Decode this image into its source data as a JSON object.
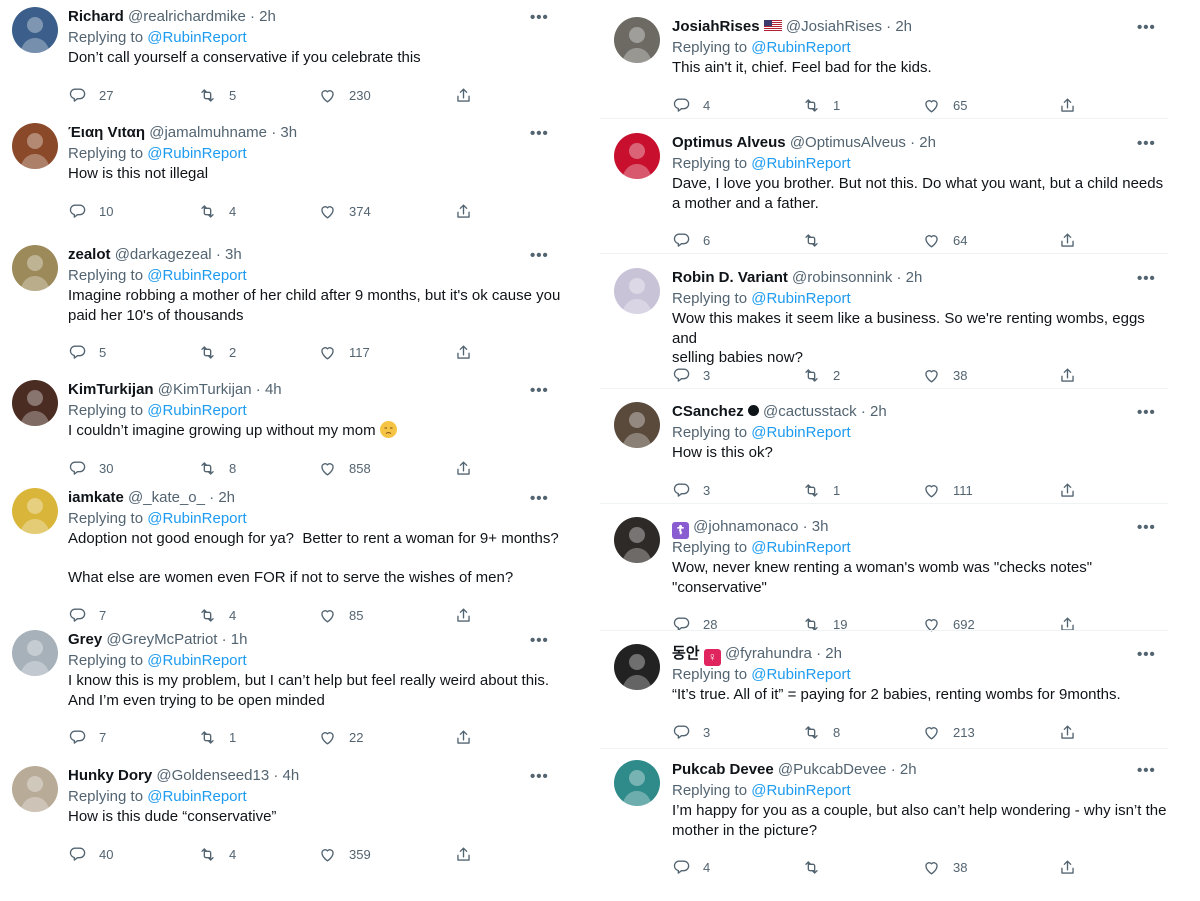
{
  "reply_prefix": "Replying to",
  "reply_to": "@RubinReport",
  "left": [
    {
      "name": "Richard",
      "handle": "@realrichardmike",
      "time": "· 2h",
      "text": "Don’t call yourself a conservative if you celebrate this",
      "replies": "27",
      "retweets": "5",
      "likes": "230",
      "avatar_color": "#3b5f8a"
    },
    {
      "name": "Έιαη Vιtαη",
      "handle": "@jamalmuhname",
      "time": "· 3h",
      "text": "How is this not illegal",
      "replies": "10",
      "retweets": "4",
      "likes": "374",
      "avatar_color": "#8a4a2a"
    },
    {
      "name": "zealot",
      "handle": "@darkagezeal",
      "time": "· 3h",
      "text": "Imagine robbing a mother of her child after 9 months, but it's ok cause you\npaid her 10's of thousands",
      "replies": "5",
      "retweets": "2",
      "likes": "117",
      "avatar_color": "#9c8a5a"
    },
    {
      "name": "KimTurkijan",
      "handle": "@KimTurkijan",
      "time": "· 4h",
      "text": "I couldn’t imagine growing up without my mom",
      "emoji": "pensive-face",
      "replies": "30",
      "retweets": "8",
      "likes": "858",
      "avatar_color": "#4a2c22"
    },
    {
      "name": "iamkate",
      "handle": "@_kate_o_",
      "time": "· 2h",
      "text": "Adoption not good enough for ya?  Better to rent a woman for 9+ months?\n\nWhat else are women even FOR if not to serve the wishes of men?",
      "replies": "7",
      "retweets": "4",
      "likes": "85",
      "avatar_color": "#d9b53a"
    },
    {
      "name": "Grey",
      "handle": "@GreyMcPatriot",
      "time": "· 1h",
      "text": "I know this is my problem, but I can’t help but feel really weird about this.\nAnd I’m even trying to be open minded",
      "replies": "7",
      "retweets": "1",
      "likes": "22",
      "avatar_color": "#a7b1ba"
    },
    {
      "name": "Hunky Dory",
      "handle": "@Goldenseed13",
      "time": "· 4h",
      "text": "How is this dude “conservative”",
      "replies": "40",
      "retweets": "4",
      "likes": "359",
      "avatar_color": "#b8ab98"
    }
  ],
  "right": [
    {
      "name": "JosiahRises",
      "handle": "@JosiahRises",
      "time": "· 2h",
      "flag": "us-flag",
      "text": "This ain't it, chief. Feel bad for the kids.",
      "replies": "4",
      "retweets": "1",
      "likes": "65",
      "avatar_color": "#6d6a64"
    },
    {
      "name": "Optimus Alveus",
      "handle": "@OptimusAlveus",
      "time": "· 2h",
      "text": "Dave, I love you brother. But not this. Do what you want, but a child needs\na mother and a father.",
      "replies": "6",
      "retweets": "",
      "likes": "64",
      "avatar_color": "#c8102e"
    },
    {
      "name": "Robin D. Variant",
      "handle": "@robinsonnink",
      "time": "· 2h",
      "text": "Wow this makes it seem like a business. So we're renting wombs, eggs and\nselling babies now?",
      "replies": "3",
      "retweets": "2",
      "likes": "38",
      "avatar_color": "#c9c3d8"
    },
    {
      "name": "CSanchez",
      "handle": "@cactusstack",
      "time": "· 2h",
      "badge": "black-circle",
      "text": "How is this ok?",
      "replies": "3",
      "retweets": "1",
      "likes": "111",
      "avatar_color": "#5a4a3c"
    },
    {
      "name": "",
      "handle": "@johnamonaco",
      "time": "· 3h",
      "symbol": "☦",
      "text": "Wow, never knew renting a woman's womb was \"checks notes\"\n\"conservative\"",
      "replies": "28",
      "retweets": "19",
      "likes": "692",
      "avatar_color": "#2e2a28"
    },
    {
      "name": "동안",
      "handle": "@fyrahundra",
      "time": "· 2h",
      "symbol": "♀",
      "text": "“It’s true. All of it” = paying for 2 babies, renting wombs for 9months.",
      "replies": "3",
      "retweets": "8",
      "likes": "213",
      "avatar_color": "#222222"
    },
    {
      "name": "Pukcab Devee",
      "handle": "@PukcabDevee",
      "time": "· 2h",
      "text": "I’m happy for you as a couple, but also can’t help wondering - why isn’t the\nmother in the picture?",
      "replies": "4",
      "retweets": "",
      "likes": "38",
      "avatar_color": "#2f8a8a"
    }
  ],
  "more_label": "•••",
  "accent": "#1d9bf0"
}
